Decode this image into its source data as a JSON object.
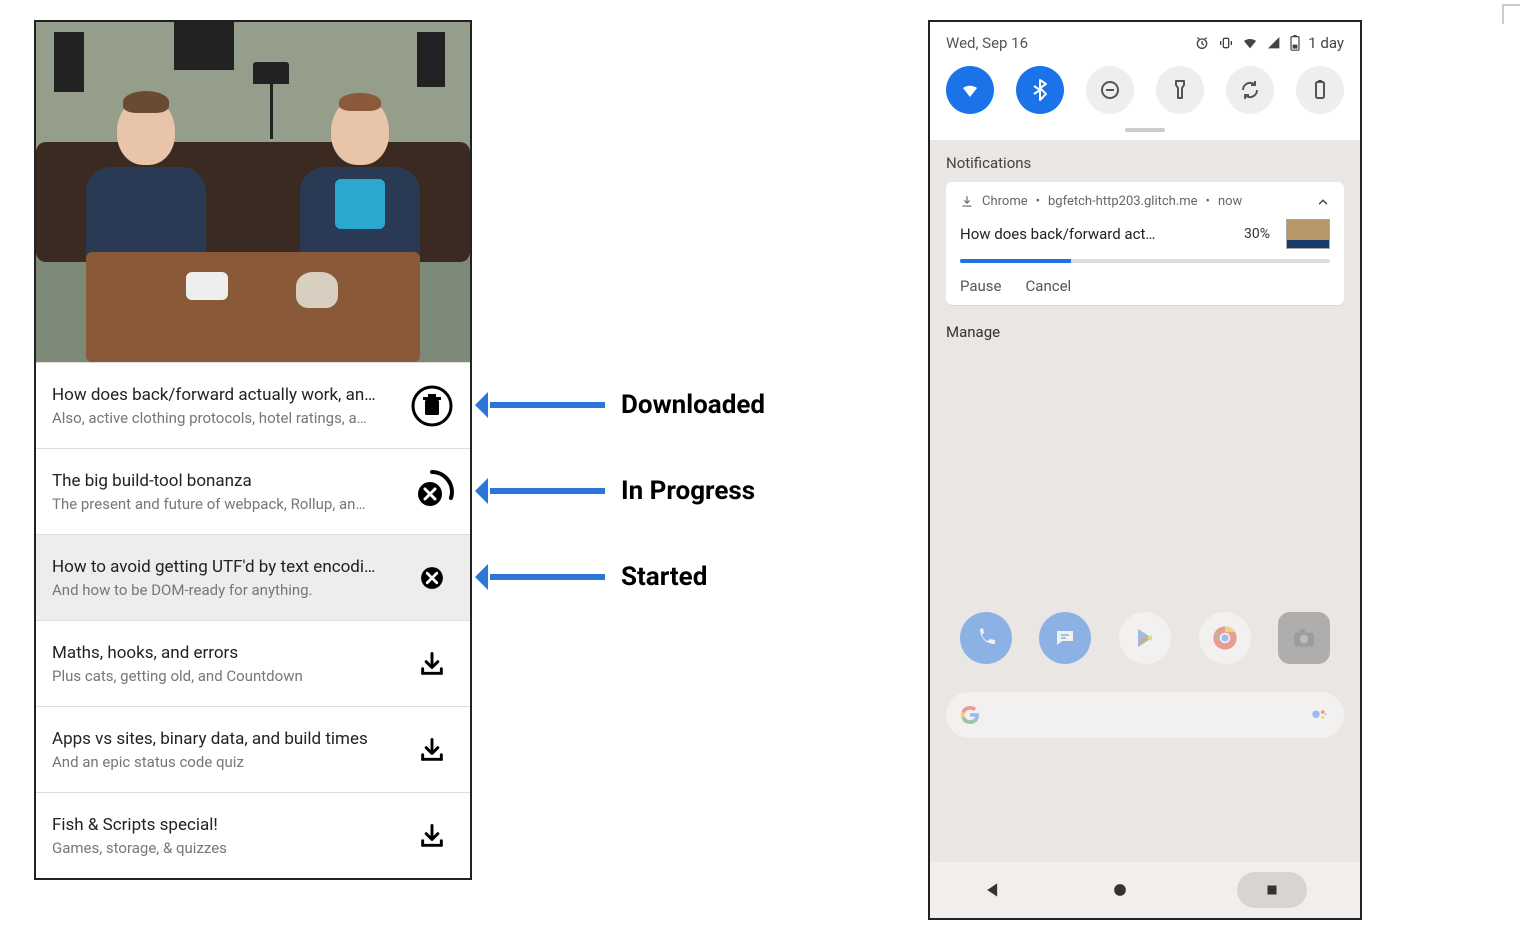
{
  "app": {
    "items": [
      {
        "title": "How does back/forward actually work, an…",
        "subtitle": "Also, active clothing protocols, hotel ratings, a…",
        "state": "downloaded"
      },
      {
        "title": "The big build-tool bonanza",
        "subtitle": "The present and future of webpack, Rollup, an…",
        "state": "in_progress"
      },
      {
        "title": "How to avoid getting UTF'd by text encodi…",
        "subtitle": "And how to be DOM-ready for anything.",
        "state": "started"
      },
      {
        "title": "Maths, hooks, and errors",
        "subtitle": "Plus cats, getting old, and Countdown",
        "state": "idle"
      },
      {
        "title": "Apps vs sites, binary data, and build times",
        "subtitle": "And an epic status code quiz",
        "state": "idle"
      },
      {
        "title": "Fish & Scripts special!",
        "subtitle": "Games, storage, & quizzes",
        "state": "idle"
      }
    ]
  },
  "annotations": {
    "downloaded": "Downloaded",
    "in_progress": "In Progress",
    "started": "Started"
  },
  "phone": {
    "date": "Wed, Sep 16",
    "status_battery_text": "1 day",
    "notifications_label": "Notifications",
    "manage_label": "Manage",
    "notification": {
      "app": "Chrome",
      "source": "bgfetch-http203.glitch.me",
      "time": "now",
      "title": "How does back/forward act…",
      "percent_text": "30%",
      "percent_value": 30,
      "actions": {
        "pause": "Pause",
        "cancel": "Cancel"
      }
    }
  }
}
